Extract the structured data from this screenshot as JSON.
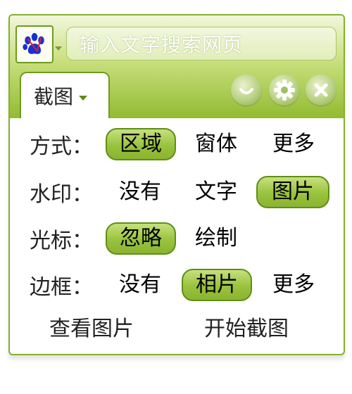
{
  "search": {
    "placeholder": "输入文字搜索网页"
  },
  "tab": {
    "label": "截图"
  },
  "rows": [
    {
      "label": "方式：",
      "options": [
        "区域",
        "窗体",
        "更多"
      ],
      "selected": 0
    },
    {
      "label": "水印：",
      "options": [
        "没有",
        "文字",
        "图片"
      ],
      "selected": 2
    },
    {
      "label": "光标：",
      "options": [
        "忽略",
        "绘制"
      ],
      "selected": 0
    },
    {
      "label": "边框：",
      "options": [
        "没有",
        "相片",
        "更多"
      ],
      "selected": 1
    }
  ],
  "actions": {
    "view": "查看图片",
    "start": "开始截图"
  },
  "icons": [
    "paw-icon",
    "smile-icon",
    "gear-icon",
    "close-icon"
  ],
  "colors": {
    "accent": "#8fb834",
    "border": "#6f9a1e"
  }
}
